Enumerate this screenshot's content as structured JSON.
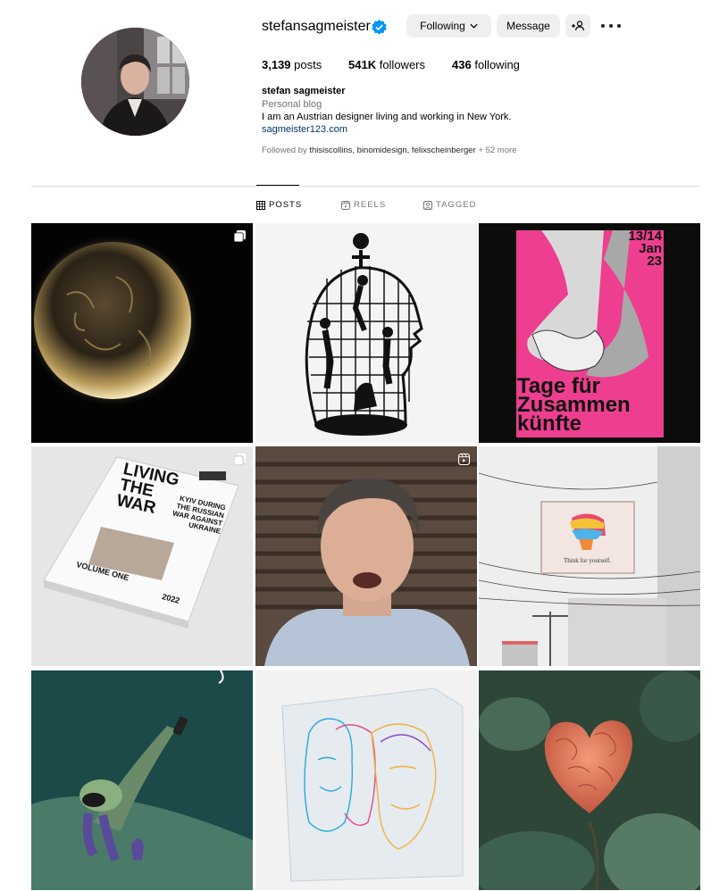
{
  "profile": {
    "username": "stefansagmeister",
    "following_label": "Following",
    "message_label": "Message",
    "stats": {
      "posts_count": "3,139",
      "posts_label": "posts",
      "followers_count": "541K",
      "followers_label": "followers",
      "following_count": "436",
      "following_label": "following"
    },
    "full_name": "stefan sagmeister",
    "category": "Personal blog",
    "bio": "I am an Austrian designer living and working in New York.",
    "link": "sagmeister123.com",
    "followed_by": {
      "prefix": "Followed by",
      "names": "thisiscollins, binomidesign, felixscheinberger",
      "suffix": "+ 52 more"
    }
  },
  "tabs": [
    {
      "label": "POSTS",
      "icon": "grid-icon",
      "active": true
    },
    {
      "label": "REELS",
      "icon": "reels-icon",
      "active": false
    },
    {
      "label": "TAGGED",
      "icon": "tagged-icon",
      "active": false
    }
  ],
  "posts": [
    {
      "subject": "glowing textured sphere",
      "badge": "carousel-icon"
    },
    {
      "subject": "wire cage head with figures",
      "badge": ""
    },
    {
      "subject": "festival poster",
      "badge": "",
      "poster": {
        "date_line1": "13/14",
        "date_line2": "Jan",
        "date_line3": "23",
        "title1": "Tage für",
        "title2": "Zusammen",
        "title3": "künfte"
      }
    },
    {
      "subject": "magazine",
      "badge": "carousel-icon",
      "magazine": {
        "title1": "LIVING",
        "title2": "THE",
        "title3": "WAR",
        "subtitle": "KYIV DURING THE RUSSIAN WAR AGAINST UKRAINE",
        "volume": "VOLUME ONE",
        "year": "2022"
      }
    },
    {
      "subject": "man speaking to camera",
      "badge": "reel-icon"
    },
    {
      "subject": "billboard",
      "badge": "",
      "billboard": {
        "caption": "Think for yourself."
      }
    },
    {
      "subject": "illustration figure with remote",
      "badge": ""
    },
    {
      "subject": "acrylic cube with faces",
      "badge": ""
    },
    {
      "subject": "brain heart on plant",
      "badge": ""
    }
  ],
  "colors": {
    "button_bg": "#efefef",
    "link": "#00376b",
    "muted": "#737373",
    "verified": "#0095f6",
    "poster_pink": "#ee3e8f"
  }
}
